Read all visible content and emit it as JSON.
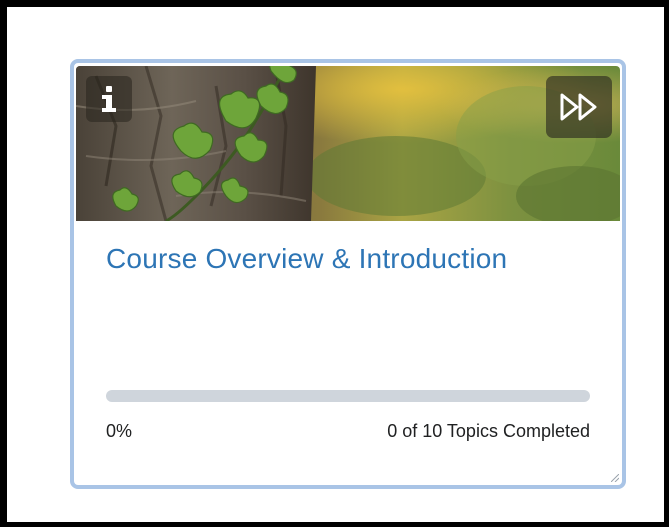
{
  "card": {
    "title": "Course Overview & Introduction",
    "progress": {
      "percent_label": "0%",
      "percent_value": 0,
      "topics_label": "0 of 10 Topics Completed"
    },
    "info_icon_glyph": "i",
    "next_icon": "fast-forward-icon",
    "info_icon": "info-icon",
    "accent_color": "#2d75b5",
    "border_color": "#a9c4e6",
    "track_color": "#cfd5dc"
  }
}
